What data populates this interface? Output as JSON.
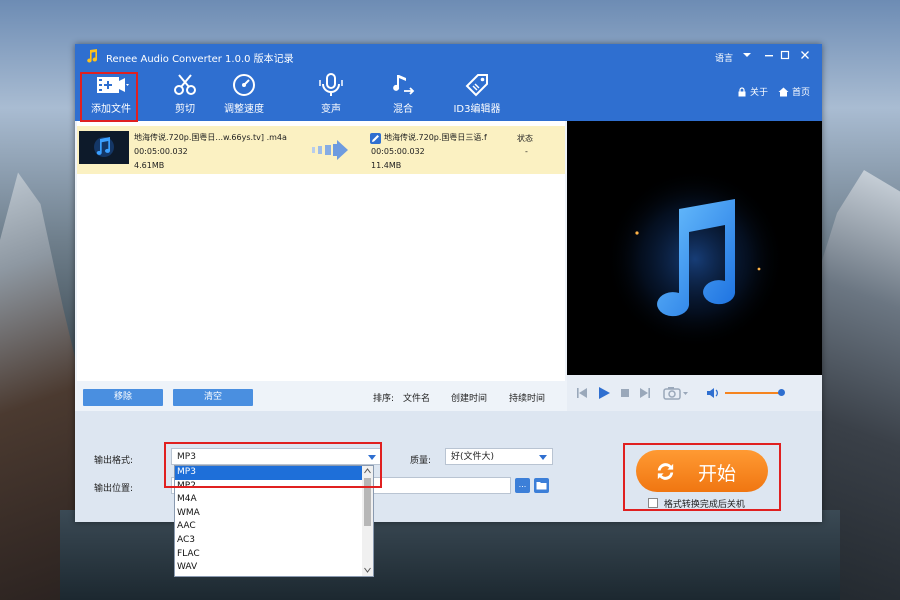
{
  "window": {
    "title": "Renee Audio Converter 1.0.0 版本记录",
    "language": "语言"
  },
  "toolbar": {
    "items": [
      {
        "label": "添加文件",
        "icon": "add-file-icon"
      },
      {
        "label": "剪切",
        "icon": "cut-icon"
      },
      {
        "label": "调整速度",
        "icon": "speed-icon"
      },
      {
        "label": "变声",
        "icon": "microphone-icon"
      },
      {
        "label": "混合",
        "icon": "mix-icon"
      },
      {
        "label": "ID3编辑器",
        "icon": "tag-icon"
      }
    ],
    "about": "关于",
    "home": "首页"
  },
  "file": {
    "input_name": "地海传说.720p.国粤日...w.66ys.tv] .m4a",
    "input_duration": "00:05:00.032",
    "input_size": "4.61MB",
    "output_name": "地海传说.720p.国粤日三语.f",
    "output_duration": "00:05:00.032",
    "output_size": "11.4MB",
    "status_label": "状态",
    "status_value": "-"
  },
  "list_buttons": {
    "remove": "移除",
    "clear": "清空"
  },
  "sort": {
    "label": "排序:",
    "by_name": "文件名",
    "by_created": "创建时间",
    "by_duration": "持续时间"
  },
  "output": {
    "format_label": "输出格式:",
    "format_value": "MP3",
    "quality_label": "质量:",
    "quality_value": "好(文件大)",
    "location_label": "输出位置:",
    "location_browse": "...",
    "format_options": [
      "MP3",
      "MP2",
      "M4A",
      "WMA",
      "AAC",
      "AC3",
      "FLAC",
      "WAV"
    ]
  },
  "start": {
    "label": "开始",
    "shutdown_label": "格式转换完成后关机"
  },
  "colors": {
    "titlebar": "#2f6fd0",
    "accent_orange": "#f5841f",
    "selection": "#1e6fd9",
    "highlight_red": "#e02020"
  }
}
